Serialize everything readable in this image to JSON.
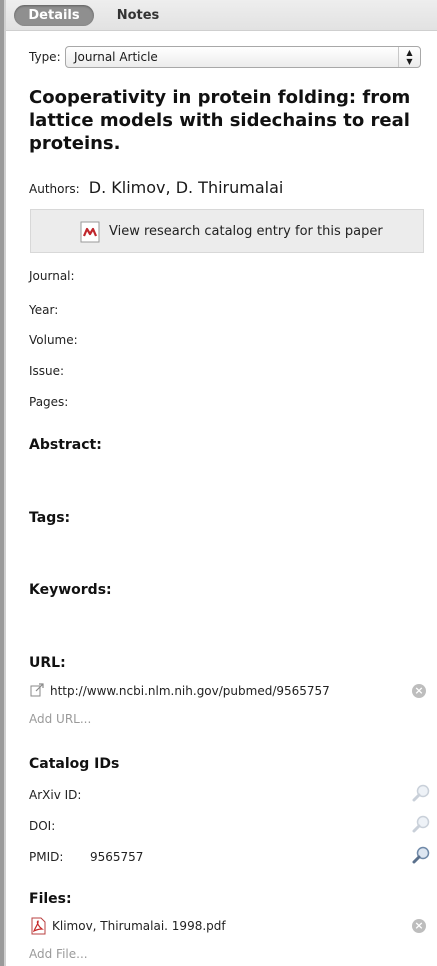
{
  "tabs": [
    {
      "label": "Details",
      "active": true
    },
    {
      "label": "Notes",
      "active": false
    }
  ],
  "type": {
    "label": "Type:",
    "value": "Journal Article"
  },
  "title": "Cooperativity in protein folding: from lattice models with sidechains to real proteins.",
  "authors": {
    "label": "Authors:",
    "value": "D. Klimov, D. Thirumalai"
  },
  "catalog_button": {
    "label": "View research catalog entry for this paper",
    "icon": "pdf-catalog-icon"
  },
  "fields": {
    "journal": "Journal:",
    "year": "Year:",
    "volume": "Volume:",
    "issue": "Issue:",
    "pages": "Pages:"
  },
  "sections": {
    "abstract": "Abstract:",
    "tags": "Tags:",
    "keywords": "Keywords:",
    "url": "URL:",
    "catalog_ids": "Catalog IDs",
    "files": "Files:"
  },
  "url": {
    "value": "http://www.ncbi.nlm.nih.gov/pubmed/9565757",
    "add_label": "Add URL..."
  },
  "catalog_ids": {
    "arxiv_label": "ArXiv ID:",
    "doi_label": "DOI:",
    "pmid_label": "PMID:",
    "pmid_value": "9565757"
  },
  "files": {
    "name": "Klimov, Thirumalai. 1998.pdf",
    "add_label": "Add File..."
  }
}
